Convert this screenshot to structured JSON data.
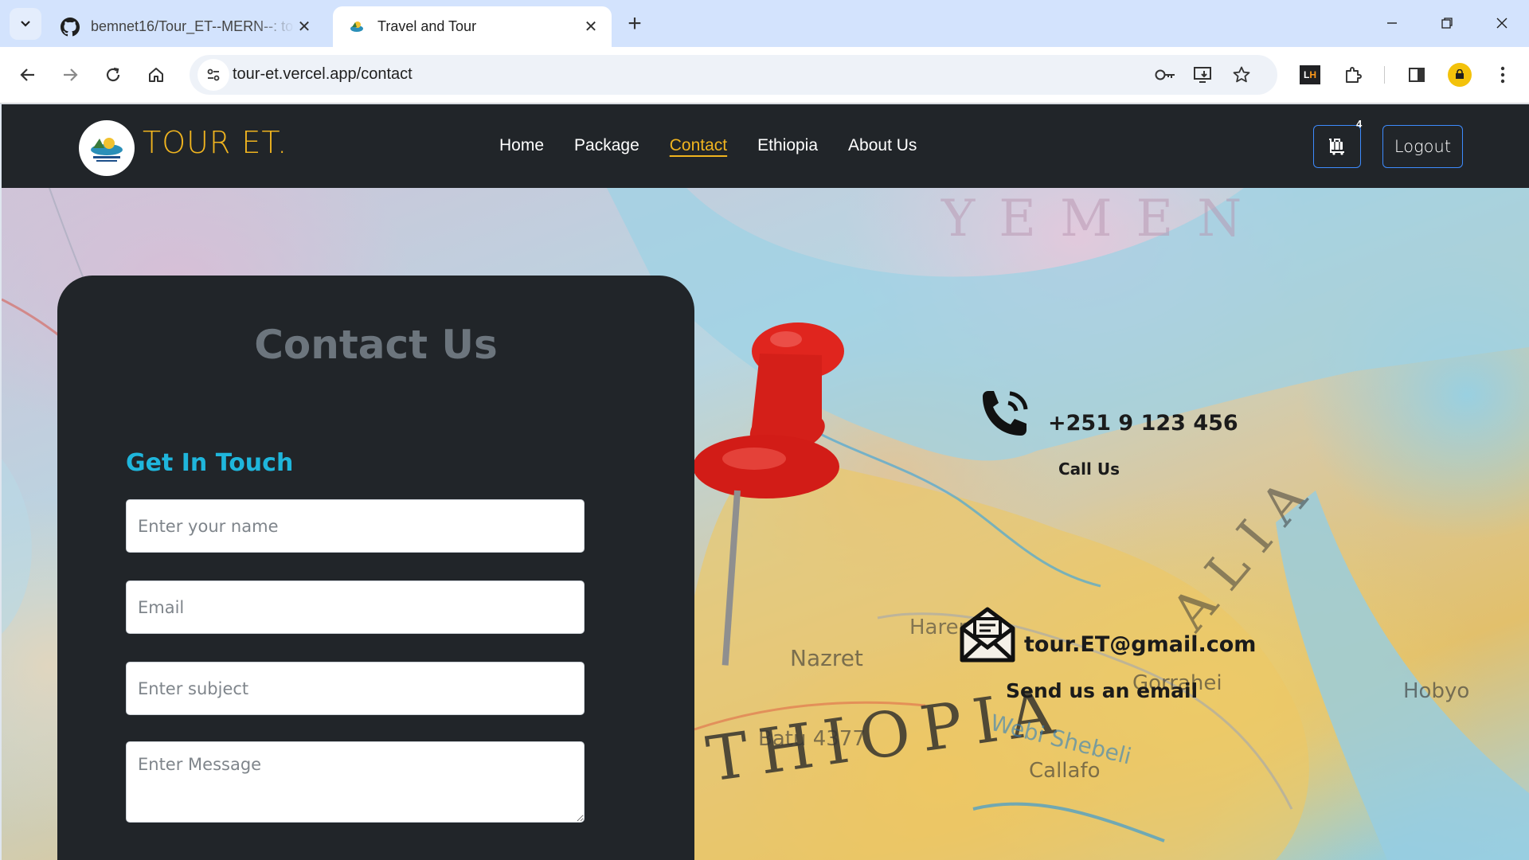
{
  "browser": {
    "tabs": [
      {
        "title": "bemnet16/Tour_ET--MERN--: to",
        "favicon": "github-icon",
        "active": false
      },
      {
        "title": "Travel and Tour",
        "favicon": "site-logo-icon",
        "active": true
      }
    ],
    "url": "tour-et.vercel.app/contact"
  },
  "navbar": {
    "brand": "TOUR ET.",
    "links": [
      "Home",
      "Package",
      "Contact",
      "Ethiopia",
      "About Us"
    ],
    "active_link": "Contact",
    "cart_count": "4",
    "logout_label": "Logout",
    "brand_color": "#f0b41f",
    "background": "#212529"
  },
  "contact_form": {
    "title": "Contact Us",
    "subtitle": "Get In Touch",
    "name_placeholder": "Enter your name",
    "email_placeholder": "Email",
    "subject_placeholder": "Enter subject",
    "message_placeholder": "Enter Message",
    "accent_color": "#1fb6dc"
  },
  "contact_info": {
    "phone": "+251 9 123 456",
    "phone_caption": "Call Us",
    "email": "tour.ET@gmail.com",
    "email_caption": "Send us an email"
  }
}
